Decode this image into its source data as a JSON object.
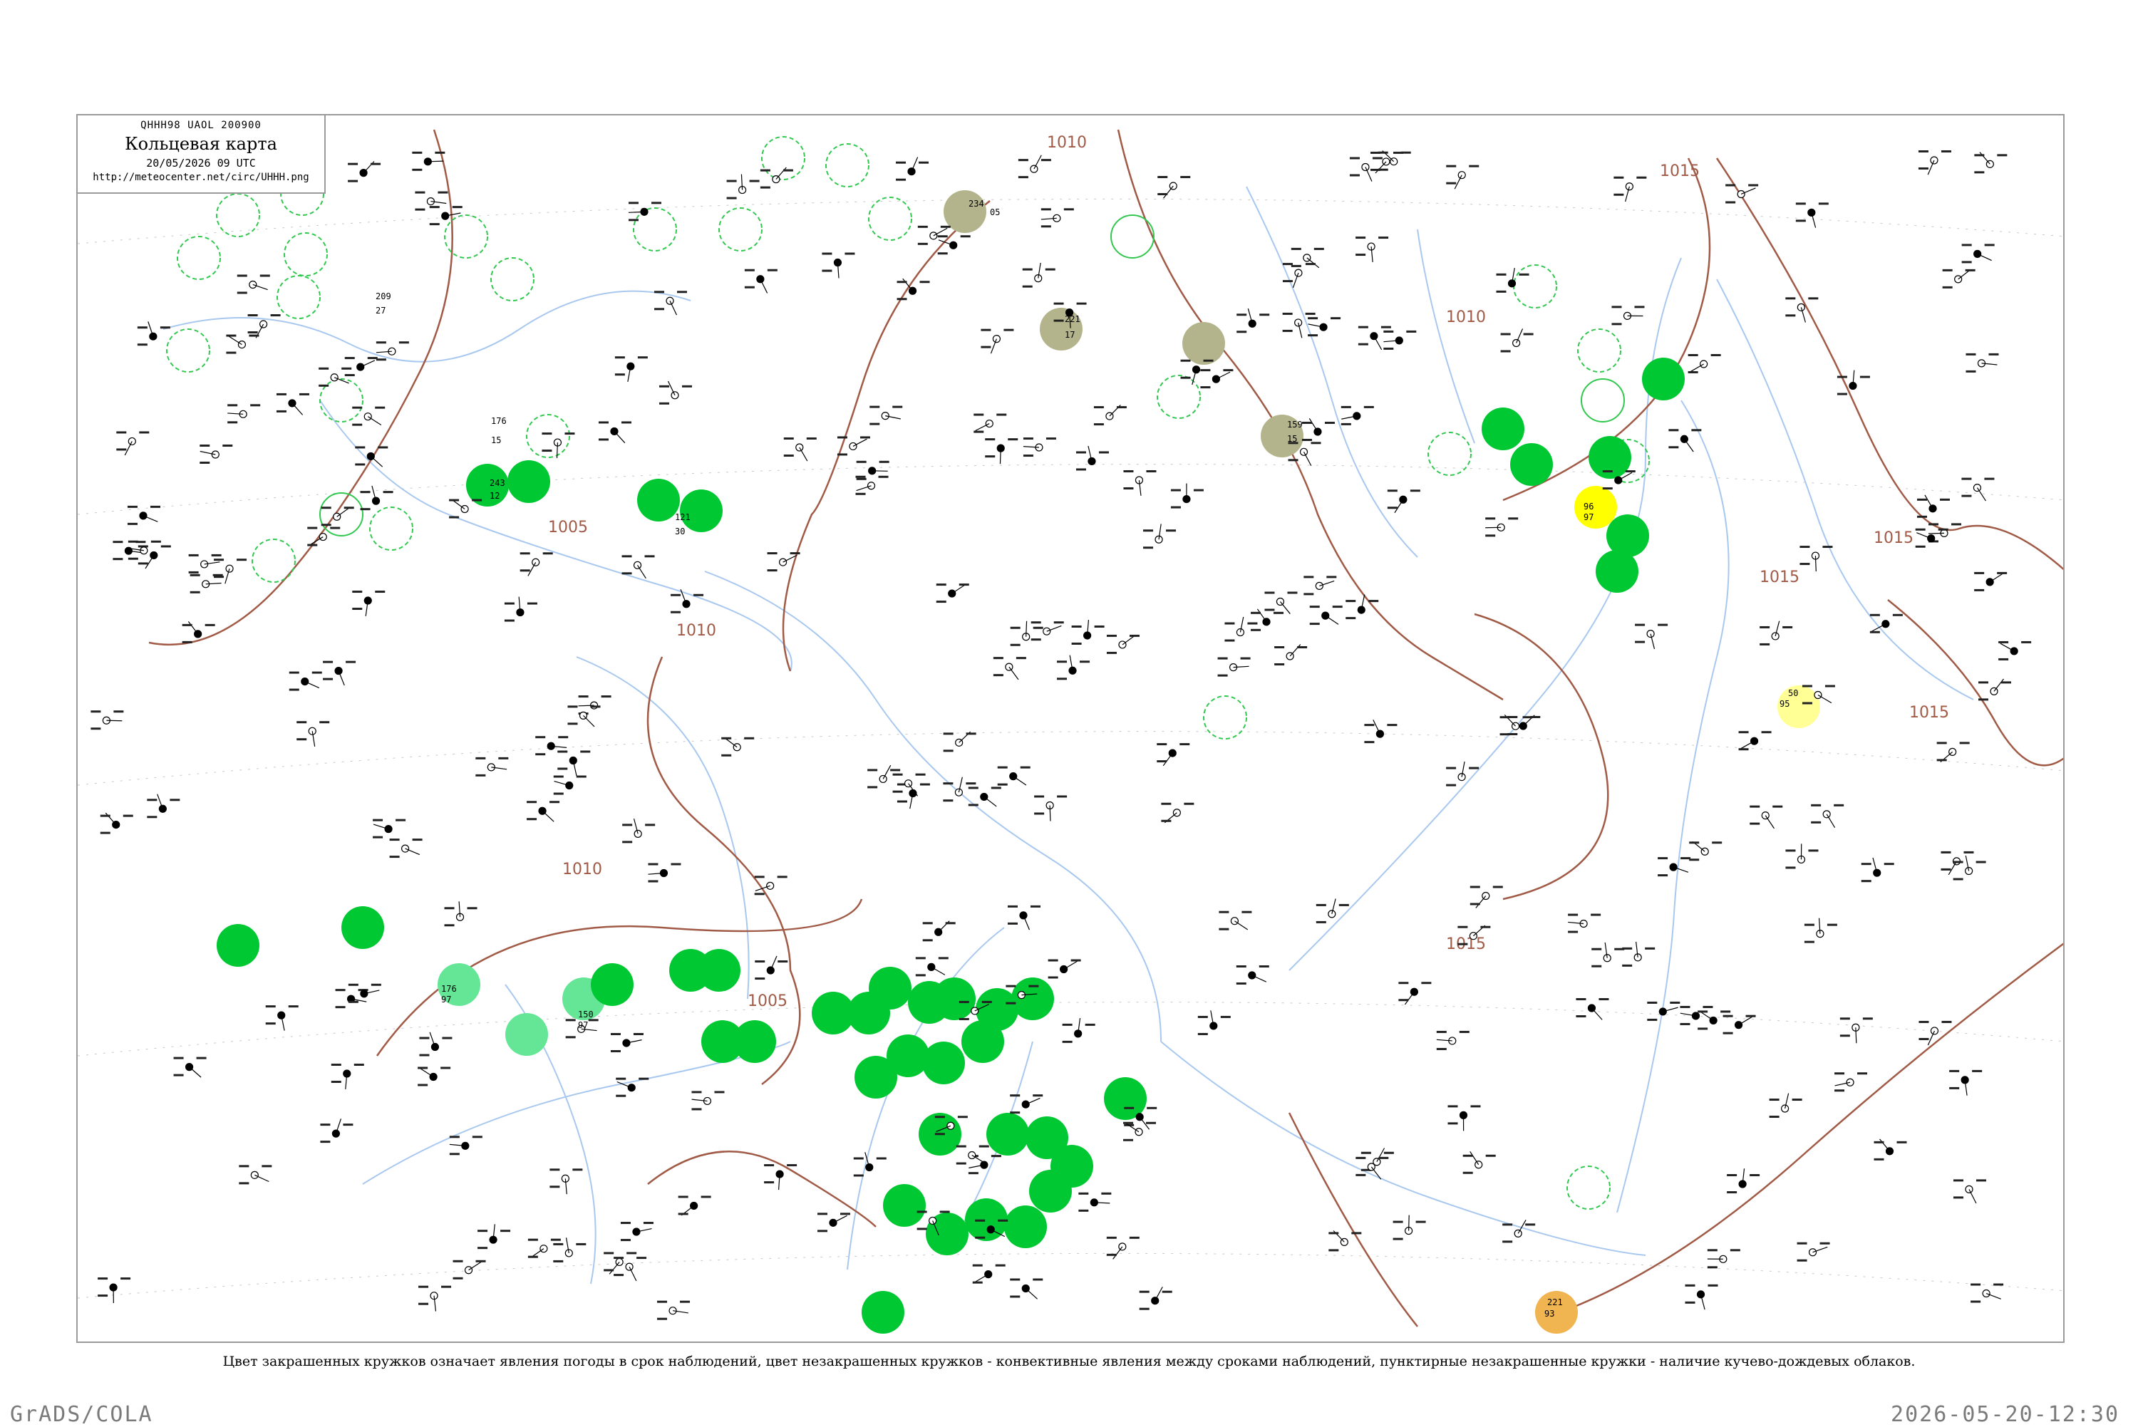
{
  "header": {
    "code_line": "QHHH98  UAOL  200900",
    "title": "Кольцевая карта",
    "date": "20/05/2026 09 UTC",
    "url": "http://meteocenter.net/circ/UHHH.png"
  },
  "isobar_labels": [
    "1005",
    "1010",
    "1015"
  ],
  "stations": [
    {
      "t": "209",
      "d": "27",
      "fill": "none"
    },
    {
      "t": "176",
      "d": "15",
      "fill": "none"
    },
    {
      "t": "243",
      "d": "12",
      "fill": "#00c832"
    },
    {
      "t": "121",
      "d": "30",
      "fill": "#00c832"
    },
    {
      "t": "234",
      "d": "05",
      "fill": "#b4b48c"
    },
    {
      "t": "221",
      "d": "17",
      "fill": "#b4b48c"
    },
    {
      "t": "159",
      "d": "15",
      "fill": "#b4b48c"
    },
    {
      "t": "96",
      "d": "97",
      "fill": "#ffff00"
    },
    {
      "t": "50",
      "d": "95",
      "fill": "#ffff96"
    },
    {
      "t": "221",
      "d": "93",
      "fill": "#f0b450"
    },
    {
      "t": "176",
      "d": "97",
      "fill": "#64e696"
    },
    {
      "t": "150",
      "d": "97",
      "fill": "#64e696"
    }
  ],
  "legend": "Цвет закрашенных кружков означает явления погоды в срок наблюдений, цвет незакрашенных кружков - конвективные явления между сроками наблюдений, пунктирные незакрашенные кружки - наличие кучево-дождевых облаков.",
  "footer": {
    "left": "GrADS/COLA",
    "right": "2026-05-20-12:30"
  },
  "colors": {
    "frame": "#9a9a9a",
    "rivers": "#a8c8f0",
    "isobars": "#a05a46",
    "thunderstorm": "#00c832",
    "shower_light": "#64e696",
    "fog_haze": "#b4b48c",
    "dust": "#ffff00",
    "dust_light": "#ffff96",
    "smoke": "#f0b450",
    "cb_circle": "#32c850"
  }
}
